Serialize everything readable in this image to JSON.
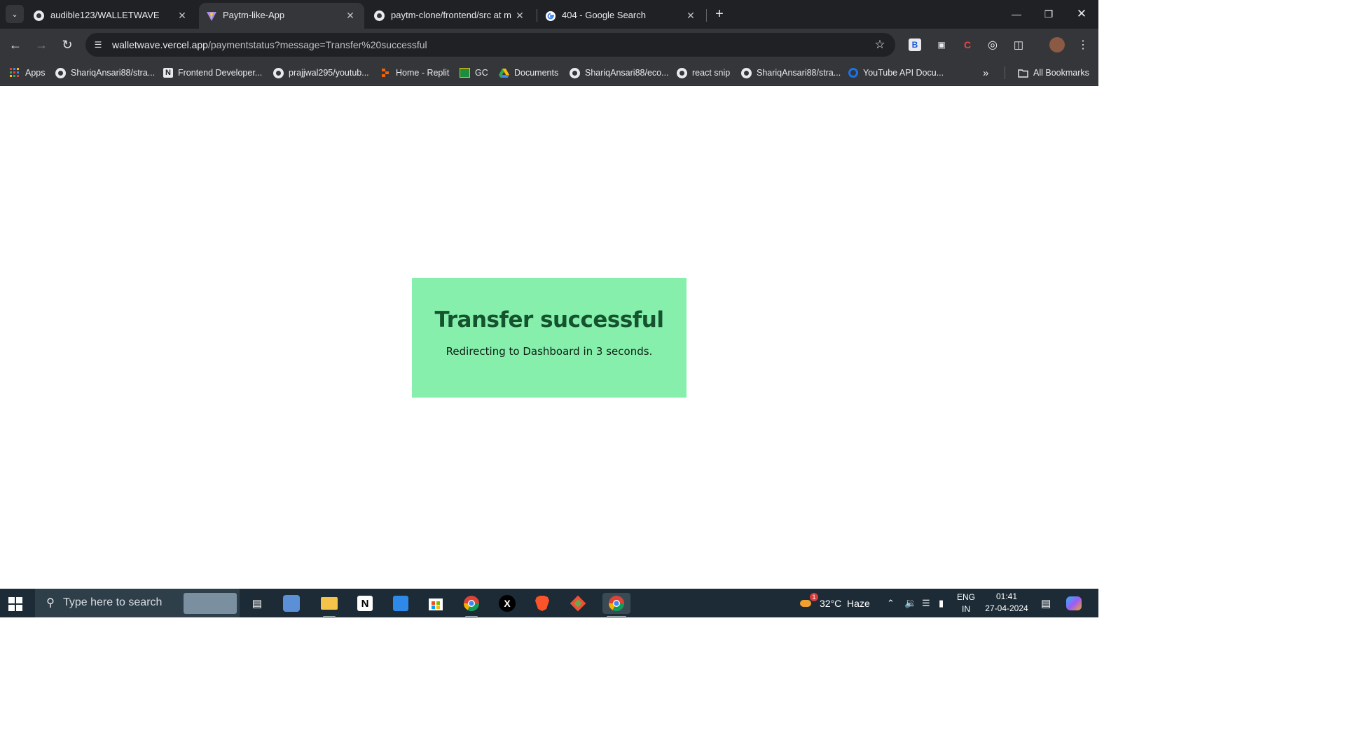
{
  "tabs": [
    {
      "title": "audible123/WALLETWAVE",
      "icon": "github-icon"
    },
    {
      "title": "Paytm-like-App",
      "icon": "vite-icon",
      "active": true
    },
    {
      "title": "paytm-clone/frontend/src at ma",
      "icon": "github-icon"
    },
    {
      "title": "404 - Google Search",
      "icon": "google-icon"
    }
  ],
  "address_bar": {
    "host": "walletwave.vercel.app",
    "path": "/paymentstatus?message=Transfer%20successful"
  },
  "bookmarks": [
    {
      "label": "Apps",
      "icon": "apps-grid-icon"
    },
    {
      "label": "ShariqAnsari88/stra...",
      "icon": "github-icon"
    },
    {
      "label": "Frontend Developer...",
      "icon": "notion-icon"
    },
    {
      "label": "prajjwal295/youtub...",
      "icon": "github-icon"
    },
    {
      "label": "Home - Replit",
      "icon": "replit-icon"
    },
    {
      "label": "GC",
      "icon": "classroom-icon"
    },
    {
      "label": "Documents",
      "icon": "drive-icon"
    },
    {
      "label": "ShariqAnsari88/eco...",
      "icon": "github-icon"
    },
    {
      "label": "react snip",
      "icon": "github-icon"
    },
    {
      "label": "ShariqAnsari88/stra...",
      "icon": "github-icon"
    },
    {
      "label": "YouTube API Docu...",
      "icon": "youtube-api-icon"
    }
  ],
  "all_bookmarks_label": "All Bookmarks",
  "status_card": {
    "title": "Transfer successful",
    "message": "Redirecting to Dashboard in 3 seconds.",
    "background": "#86efac",
    "title_color": "#14532d"
  },
  "taskbar": {
    "search_placeholder": "Type here to search",
    "weather": "32°C  Haze",
    "weather_badge": "1",
    "language": "ENG",
    "region": "IN",
    "time": "01:41",
    "date": "27-04-2024"
  }
}
